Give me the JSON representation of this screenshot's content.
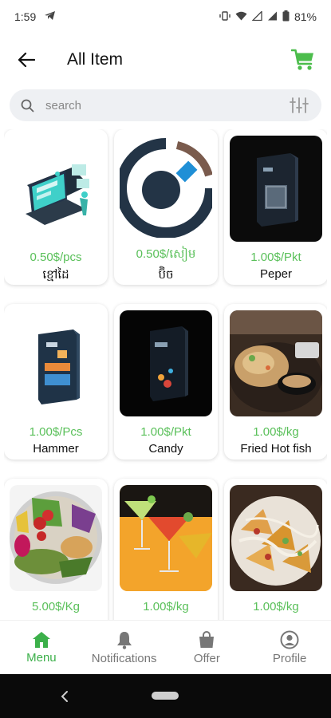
{
  "status_bar": {
    "time": "1:59",
    "battery": "81%"
  },
  "header": {
    "title": "All Item"
  },
  "search": {
    "placeholder": "search"
  },
  "colors": {
    "accent": "#5ac05a",
    "nav_active": "#3cb04a"
  },
  "products": [
    {
      "price": "0.50$/pcs",
      "name": "ខ្មៅដៃ",
      "image": "laptop-illustration"
    },
    {
      "price": "0.50$/សៀម",
      "name": "ប៊ិច",
      "image": "circle-logo"
    },
    {
      "price": "1.00$/Pkt",
      "name": "Peper",
      "image": "dark-box"
    },
    {
      "price": "1.00$/Pcs",
      "name": "Hammer",
      "image": "book-box"
    },
    {
      "price": "1.00$/Pkt",
      "name": "Candy",
      "image": "black-box"
    },
    {
      "price": "1.00$/kg",
      "name": "Fried Hot fish",
      "image": "fried-food-photo"
    },
    {
      "price": "5.00$/Kg",
      "name": "",
      "image": "salad-bowl-photo"
    },
    {
      "price": "1.00$/kg",
      "name": "",
      "image": "cocktails-photo"
    },
    {
      "price": "1.00$/kg",
      "name": "",
      "image": "nachos-photo"
    }
  ],
  "bottom_nav": [
    {
      "label": "Menu",
      "icon": "home-icon",
      "active": true
    },
    {
      "label": "Notifications",
      "icon": "bell-icon",
      "active": false
    },
    {
      "label": "Offer",
      "icon": "shopping-bag-icon",
      "active": false
    },
    {
      "label": "Profile",
      "icon": "profile-icon",
      "active": false
    }
  ]
}
